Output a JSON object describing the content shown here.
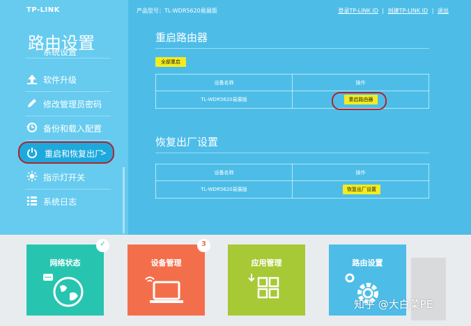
{
  "brand": {
    "logo": "TP-LINK"
  },
  "header": {
    "product_label": "产品型号：TL-WDR5620易展版",
    "link_login": "登录TP-LINK ID",
    "link_create": "创建TP-LINK ID",
    "link_exit": "退出",
    "separator": "|"
  },
  "sidebar": {
    "title": "路由设置",
    "items": [
      {
        "label": "系统设置",
        "icon": "gear-icon"
      },
      {
        "label": "软件升级",
        "icon": "upload-icon"
      },
      {
        "label": "修改管理员密码",
        "icon": "pencil-icon"
      },
      {
        "label": "备份和载入配置",
        "icon": "restore-icon"
      },
      {
        "label": "重启和恢复出厂",
        "icon": "power-icon",
        "chevron": ">"
      },
      {
        "label": "指示灯开关",
        "icon": "light-icon"
      },
      {
        "label": "系统日志",
        "icon": "list-icon"
      }
    ]
  },
  "reboot": {
    "title": "重启路由器",
    "reboot_all_label": "全部重启",
    "col_device": "设备名称",
    "col_action": "操作",
    "device_name": "TL-WDR5620易展版",
    "action_label": "重启路由器"
  },
  "reset": {
    "title": "恢复出厂设置",
    "col_device": "设备名称",
    "col_action": "操作",
    "device_name": "TL-WDR5620易展版",
    "action_label": "恢复出厂设置"
  },
  "tiles": [
    {
      "label": "网络状态",
      "color": "#27c5b0",
      "badge": "✓",
      "badge_color": "#27c5b0",
      "icon": "globe-icon"
    },
    {
      "label": "设备管理",
      "color": "#f36f4c",
      "badge": "3",
      "badge_color": "#f36f4c",
      "icon": "laptop-icon"
    },
    {
      "label": "应用管理",
      "color": "#a7c935",
      "icon": "apps-icon"
    },
    {
      "label": "路由设置",
      "color": "#4dbde8",
      "icon": "gear-icon"
    }
  ],
  "watermark": "知乎 @大白菜PE",
  "colors": {
    "accent": "#4dbde8",
    "sidebar": "#66cbef",
    "button": "#f4ec1e",
    "highlight": "#b0232a"
  }
}
